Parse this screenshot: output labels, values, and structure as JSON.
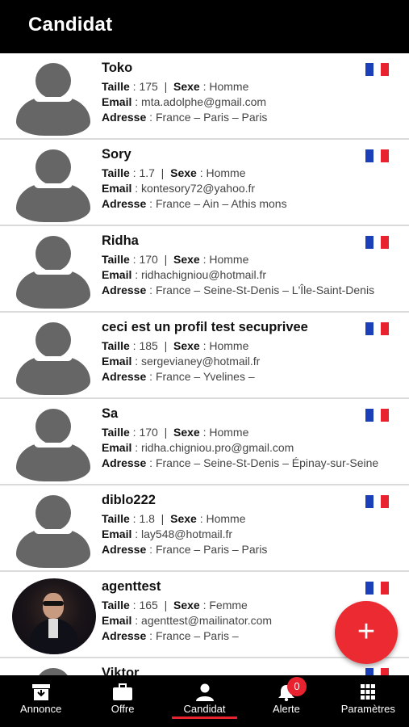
{
  "header": {
    "title": "Candidat"
  },
  "labels": {
    "taille": "Taille",
    "sexe": "Sexe",
    "email": "Email",
    "adresse": "Adresse"
  },
  "candidates": [
    {
      "name": "Toko",
      "taille": "175",
      "sexe": "Homme",
      "email": "mta.adolphe@gmail.com",
      "adresse": "France – Paris – Paris",
      "avatar": "default"
    },
    {
      "name": "Sory",
      "taille": "1.7",
      "sexe": "Homme",
      "email": "kontesory72@yahoo.fr",
      "adresse": "France – Ain – Athis mons",
      "avatar": "default"
    },
    {
      "name": "Ridha",
      "taille": "170",
      "sexe": "Homme",
      "email": "ridhachigniou@hotmail.fr",
      "adresse": "France – Seine-St-Denis – L'Île-Saint-Denis",
      "avatar": "default"
    },
    {
      "name": "ceci est un profil test secuprivee",
      "taille": "185",
      "sexe": "Homme",
      "email": "sergevianey@hotmail.fr",
      "adresse": "France – Yvelines –",
      "avatar": "default"
    },
    {
      "name": "Sa",
      "taille": "170",
      "sexe": "Homme",
      "email": "ridha.chigniou.pro@gmail.com",
      "adresse": "France – Seine-St-Denis – Épinay-sur-Seine",
      "avatar": "default"
    },
    {
      "name": "diblo222",
      "taille": "1.8",
      "sexe": "Homme",
      "email": "lay548@hotmail.fr",
      "adresse": "France – Paris – Paris",
      "avatar": "default"
    },
    {
      "name": "agenttest",
      "taille": "165",
      "sexe": "Femme",
      "email": "agenttest@mailinator.com",
      "adresse": "France – Paris –",
      "avatar": "photo"
    },
    {
      "name": "Viktor",
      "taille": "",
      "sexe": "",
      "email": "",
      "adresse": "",
      "avatar": "default"
    }
  ],
  "fab": {
    "label": "+"
  },
  "nav": [
    {
      "label": "Annonce",
      "icon": "archive-icon"
    },
    {
      "label": "Offre",
      "icon": "briefcase-icon"
    },
    {
      "label": "Candidat",
      "icon": "person-icon",
      "active": true
    },
    {
      "label": "Alerte",
      "icon": "bell-icon"
    },
    {
      "label": "Paramètres",
      "icon": "grid-icon"
    }
  ],
  "alert_badge": "0",
  "colors": {
    "accent": "#e8232f",
    "header": "#000000",
    "avatar": "#666666",
    "flag_blue": "#1a3fb8",
    "flag_red": "#e8232f"
  }
}
